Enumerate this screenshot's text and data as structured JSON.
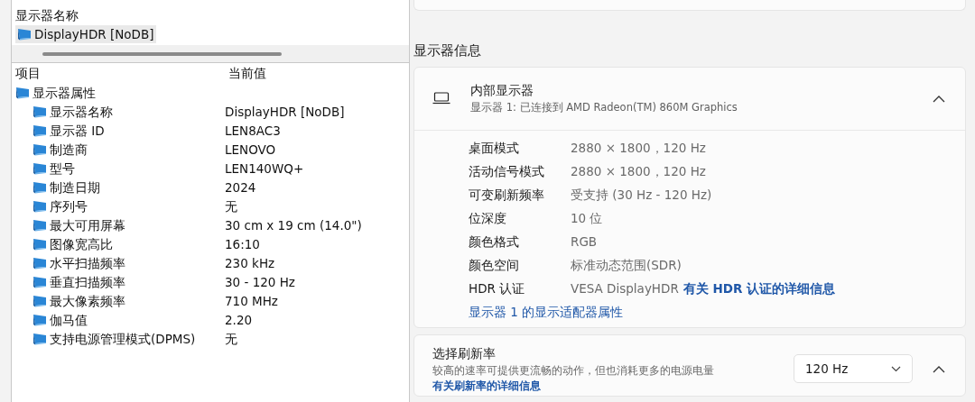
{
  "left_panel": {
    "top_list": {
      "header": "显示器名称",
      "items": [
        {
          "label": "DisplayHDR [NoDB]",
          "selected": true
        }
      ]
    },
    "columns": [
      "项目",
      "当前值"
    ],
    "tree": [
      {
        "label": "显示器属性",
        "children": [
          {
            "label": "显示器名称",
            "value": "DisplayHDR [NoDB]"
          },
          {
            "label": "显示器 ID",
            "value": "LEN8AC3"
          },
          {
            "label": "制造商",
            "value": "LENOVO"
          },
          {
            "label": "型号",
            "value": "LEN140WQ+"
          },
          {
            "label": "制造日期",
            "value": "2024"
          },
          {
            "label": "序列号",
            "value": "无"
          },
          {
            "label": "最大可用屏幕",
            "value": "30 cm x 19 cm (14.0\")"
          },
          {
            "label": "图像宽高比",
            "value": "16:10"
          },
          {
            "label": "水平扫描频率",
            "value": "230 kHz"
          },
          {
            "label": "垂直扫描频率",
            "value": "30 - 120 Hz"
          },
          {
            "label": "最大像素频率",
            "value": "710 MHz"
          },
          {
            "label": "伽马值",
            "value": "2.20"
          },
          {
            "label": "支持电源管理模式(DPMS)",
            "value": "无"
          }
        ]
      }
    ]
  },
  "right_panel": {
    "section_title": "显示器信息",
    "display_card": {
      "title": "内部显示器",
      "subtitle": "显示器 1: 已连接到 AMD Radeon(TM)  860M Graphics",
      "expanded": true,
      "properties": [
        {
          "label": "桌面模式",
          "value": "2880 × 1800，120 Hz"
        },
        {
          "label": "活动信号模式",
          "value": "2880 × 1800，120 Hz"
        },
        {
          "label": "可变刷新频率",
          "value": "受支持 (30 Hz - 120 Hz)"
        },
        {
          "label": "位深度",
          "value": "10 位"
        },
        {
          "label": "颜色格式",
          "value": "RGB"
        },
        {
          "label": "颜色空间",
          "value": "标准动态范围(SDR)"
        },
        {
          "label": "HDR 认证",
          "value": "VESA DisplayHDR",
          "link": "有关 HDR 认证的详细信息"
        }
      ],
      "adapter_link": "显示器 1 的显示适配器属性"
    },
    "refresh_card": {
      "title": "选择刷新率",
      "description": "较高的速率可提供更流畅的动作，但也消耗更多的电源电量",
      "link": "有关刷新率的详细信息",
      "dropdown": {
        "value": "120 Hz"
      },
      "expanded": true
    }
  }
}
